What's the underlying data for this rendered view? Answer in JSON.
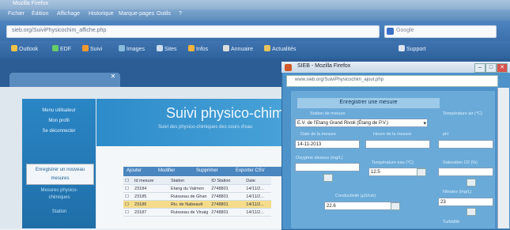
{
  "window": {
    "title": "Mozilla Firefox"
  },
  "menu": [
    "Fichier",
    "Édition",
    "Affichage",
    "Historique",
    "Marque-pages",
    "Outils",
    "?"
  ],
  "address": {
    "url": "sieb.org/SuiviPhysicochim_affiche.php"
  },
  "search": {
    "placeholder": "Google"
  },
  "bookmarks": [
    "Outlook",
    "EDF",
    "Suivi",
    "Images",
    "Sites",
    "Infos",
    "Annuaire",
    "Actualités",
    "Support"
  ],
  "page": {
    "banner_title": "Suivi physico-chimique",
    "banner_subtitle": "Suivi des physico-chimiques des cours d'eau",
    "sidebar_top": [
      "Menu utilisateur",
      "Mon profil",
      "Se déconnecter"
    ],
    "sidebar_box": [
      "Enregistrer un nouveau",
      "mesures"
    ],
    "sidebar_bottom": [
      "Mesures physico-",
      "chimiques",
      "Station"
    ]
  },
  "table": {
    "toolbar": [
      "Ajouter",
      "Modifier",
      "Supprimer",
      "Exporter CSV"
    ],
    "header": [
      "Id mesure",
      "Station",
      "ID Station",
      "Date"
    ],
    "rows": [
      [
        "23184",
        "Etang du Valmon",
        "2748801",
        "14/11/2..."
      ],
      [
        "23185",
        "Ruisseau de Ghan",
        "2748801",
        "14/11/2..."
      ],
      [
        "23186",
        "Riv. de Nabeault",
        "2748801",
        "14/11/2..."
      ],
      [
        "23187",
        "Ruisseau de Vinaig",
        "2748801",
        "14/11/2..."
      ]
    ],
    "highlight_index": 2
  },
  "popup": {
    "title": "SIEB - Mozilla Firefox",
    "url": "www.sieb.org/SuiviPhysicochim_ajout.php",
    "form_title": "Enregistrer une mesure",
    "labels": {
      "station": "Station de mesure",
      "date": "Date de la mesure",
      "time": "Heure de la mesure",
      "temp_air": "Température air (°C)",
      "ph": "pH",
      "temp_eau": "Température eau (°C)",
      "oxygen": "Oxygène dissous (mg/L)",
      "conductivity": "Conductivité (µS/cm)",
      "saturation": "Saturation O2 (%)",
      "nitrates": "Nitrates (mg/L)",
      "turbidity": "Turbidité"
    },
    "values": {
      "station": "E.V. de l'Etang Grand Rivoli (Étang de P.V.)",
      "date": "14-11-2013",
      "temp_eau": "12.5",
      "conductivity": "22.6",
      "nitrates": "23"
    }
  },
  "colors": {
    "accent": "#4d92c9",
    "highlight_row": "#f5dc8a"
  }
}
